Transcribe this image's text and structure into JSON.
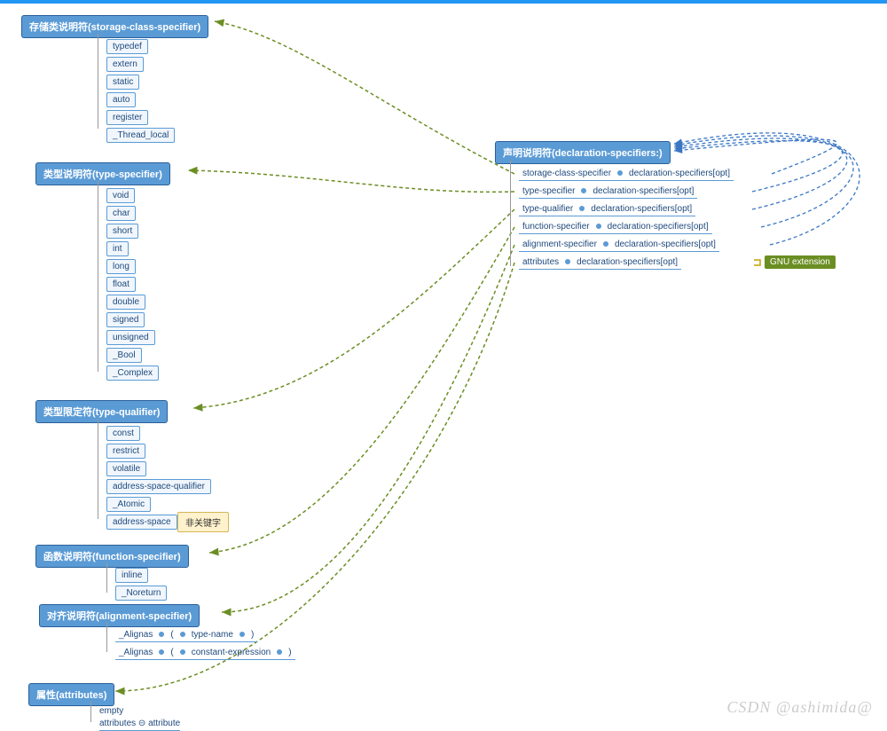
{
  "watermark": "CSDN @ashimida@",
  "headers": {
    "storage": "存储类说明符(storage-class-specifier)",
    "typespec": "类型说明符(type-specifier)",
    "typequal": "类型限定符(type-qualifier)",
    "funcspec": "函数说明符(function-specifier)",
    "alignspec": "对齐说明符(alignment-specifier)",
    "attributes": "属性(attributes)",
    "declspec": "声明说明符(declaration-specifiers:)"
  },
  "storage_items": [
    "typedef",
    "extern",
    "static",
    "auto",
    "register",
    "_Thread_local"
  ],
  "typespec_items": [
    "void",
    "char",
    "short",
    "int",
    "long",
    "float",
    "double",
    "signed",
    "unsigned",
    "_Bool",
    "_Complex"
  ],
  "typequal_items": [
    "const",
    "restrict",
    "volatile",
    "address-space-qualifier",
    "_Atomic",
    "address-space"
  ],
  "typequal_note": "非关键字",
  "funcspec_items": [
    "inline",
    "_Noreturn"
  ],
  "alignspec_rows": [
    {
      "head": "_Alignas",
      "body": "type-name"
    },
    {
      "head": "_Alignas",
      "body": "constant-expression"
    }
  ],
  "attributes_rows": [
    "empty",
    "attributes ⊝ attribute"
  ],
  "declspec_rows": [
    {
      "lhs": "storage-class-specifier",
      "rhs": "declaration-specifiers[opt]"
    },
    {
      "lhs": "type-specifier",
      "rhs": "declaration-specifiers[opt]"
    },
    {
      "lhs": "type-qualifier",
      "rhs": "declaration-specifiers[opt]"
    },
    {
      "lhs": "function-specifier",
      "rhs": "declaration-specifiers[opt]"
    },
    {
      "lhs": "alignment-specifier",
      "rhs": "declaration-specifiers[opt]"
    },
    {
      "lhs": "attributes",
      "rhs": "declaration-specifiers[opt]"
    }
  ],
  "gnu_tag": "GNU extension"
}
